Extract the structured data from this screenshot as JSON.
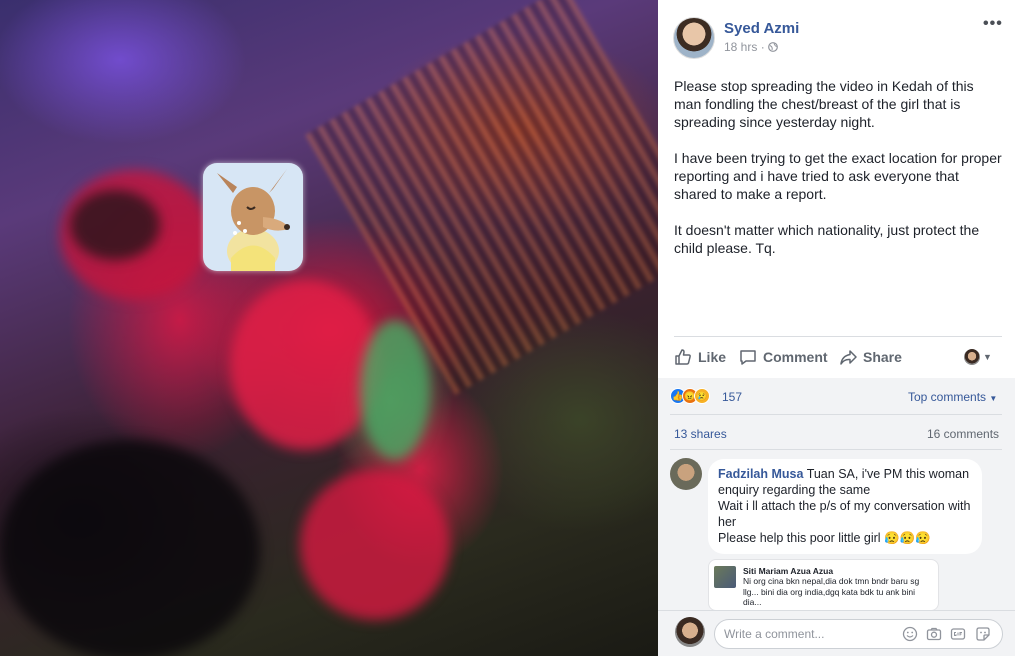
{
  "post": {
    "author": "Syed Azmi",
    "time": "18 hrs",
    "time_separator": "·",
    "paragraphs": [
      "Please stop spreading the video in Kedah of this man fondling the chest/breast of the girl that is spreading since yesterday night.",
      "I have been trying to get the exact location for proper reporting and i have tried to ask everyone that shared to make a report.",
      "It doesn't matter which nationality, just protect the child please. Tq."
    ]
  },
  "actions": {
    "like": "Like",
    "comment": "Comment",
    "share": "Share"
  },
  "reactions": {
    "count": "157",
    "icons": [
      "like-reaction-icon",
      "angry-reaction-icon",
      "sad-reaction-icon"
    ],
    "colors": {
      "like": "#1877f2",
      "angry": "#e9710f",
      "sad": "#f7b125"
    }
  },
  "stats": {
    "shares": "13 shares",
    "comments": "16 comments",
    "sort": "Top comments"
  },
  "comments": [
    {
      "author": "Fadzilah Musa",
      "lines": [
        "Tuan SA, i've PM this woman enquiry regarding the same",
        "Wait i ll attach the p/s of my conversation with her",
        "Please help this poor little girl 😥😥😥"
      ]
    },
    {
      "author": "Siti Mariam Azua Azua",
      "text": "Ni org cina bkn nepal,dia dok tmn bndr baru sg llg... bini dia org india,dgq kata bdk tu ank bini dia..."
    }
  ],
  "composer": {
    "placeholder": "Write a comment..."
  },
  "theme": {
    "link": "#365899",
    "text": "#1d2129",
    "muted": "#90949c"
  }
}
